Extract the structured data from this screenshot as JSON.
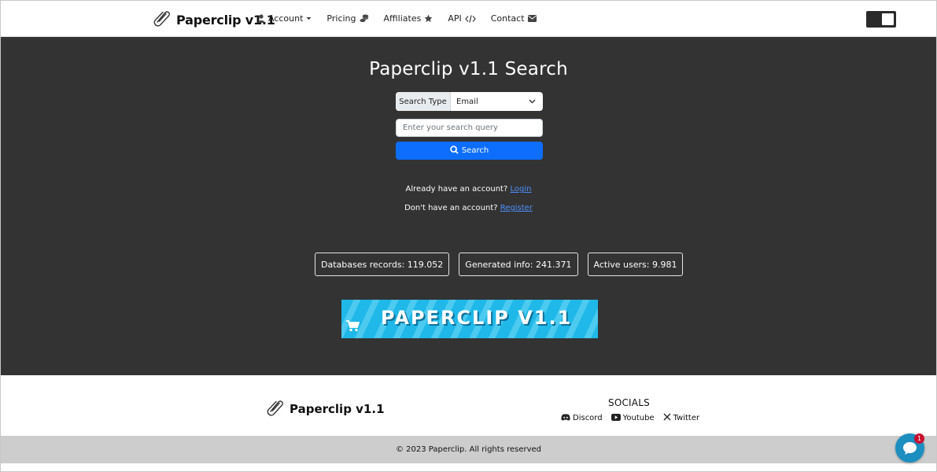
{
  "navbar": {
    "brand": "Paperclip v1.1",
    "items": [
      {
        "label": "Account",
        "icon": "user-icon"
      },
      {
        "label": "Pricing",
        "icon": "coins-icon"
      },
      {
        "label": "Affiliates",
        "icon": "star-icon"
      },
      {
        "label": "API",
        "icon": "code-icon"
      },
      {
        "label": "Contact",
        "icon": "envelope-icon"
      }
    ],
    "theme_toggle": "dark"
  },
  "hero": {
    "title": "Paperclip v1.1 Search",
    "search_type_label": "Search Type",
    "search_type_value": "Email",
    "query_placeholder": "Enter your search query",
    "search_button": "Search",
    "login_prompt": "Already have an account?",
    "login_link": "Login",
    "register_prompt": "Don't have an account?",
    "register_link": "Register"
  },
  "stats": [
    {
      "label": "Databases records:",
      "value": "119.052"
    },
    {
      "label": "Generated info:",
      "value": "241.371"
    },
    {
      "label": "Active users:",
      "value": "9.981"
    }
  ],
  "banner": {
    "text": "PAPERCLIP V1.1"
  },
  "footer": {
    "brand": "Paperclip v1.1",
    "socials_title": "SOCIALS",
    "socials": [
      {
        "label": "Discord",
        "icon": "discord-icon"
      },
      {
        "label": "Youtube",
        "icon": "youtube-icon"
      },
      {
        "label": "Twitter",
        "icon": "x-twitter-icon"
      }
    ],
    "copyright": "© 2023 Paperclip. All rights reserved"
  },
  "chat": {
    "badge_count": "1"
  },
  "colors": {
    "hero_bg": "#333333",
    "primary": "#0d6efd",
    "link": "#4d90fe",
    "banner": "#1fb8e8",
    "chat": "#1c8ec0",
    "badge": "#c8102e"
  }
}
